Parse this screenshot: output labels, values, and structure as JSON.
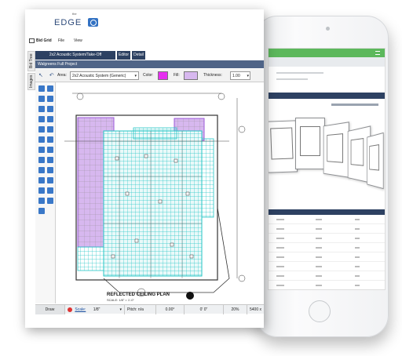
{
  "app": {
    "logo_superscript": "the",
    "logo_text": "EDGE",
    "menu": [
      "Bid Grid",
      "File",
      "View"
    ],
    "side_tabs": [
      "Bid Tree",
      "Images"
    ],
    "tabs": [
      "2x2 Acoustic System/Take-Off",
      "Editor",
      "Detail"
    ],
    "project_title": "Walgreens Full Project",
    "properties": {
      "area_label": "Area:",
      "area_value": "2x2 Acoustic System (Generic)",
      "color_label": "Color:",
      "color_value": "#e62ef0",
      "fill_label": "Fill:",
      "fill_value": "#d7b8ef",
      "thickness_label": "Thickness:",
      "thickness_value": "1.00"
    },
    "drawing": {
      "title": "REFLECTED CEILING PLAN",
      "scale_note": "SCALE: 1/8\" = 1'-0\""
    },
    "status": {
      "draw": "Draw",
      "scale_label": "Scale:",
      "scale_value": "1/8\"",
      "pitch": "Pitch: n/a",
      "angle": "0.00°",
      "length": "0' 0\"",
      "zoom": "20%",
      "extra": "5400 x"
    },
    "colors": {
      "navy": "#2d4162",
      "grid_cyan": "#27c6c6",
      "purple_fill": "#d7b8ef",
      "green_header": "#5cb85c"
    }
  }
}
